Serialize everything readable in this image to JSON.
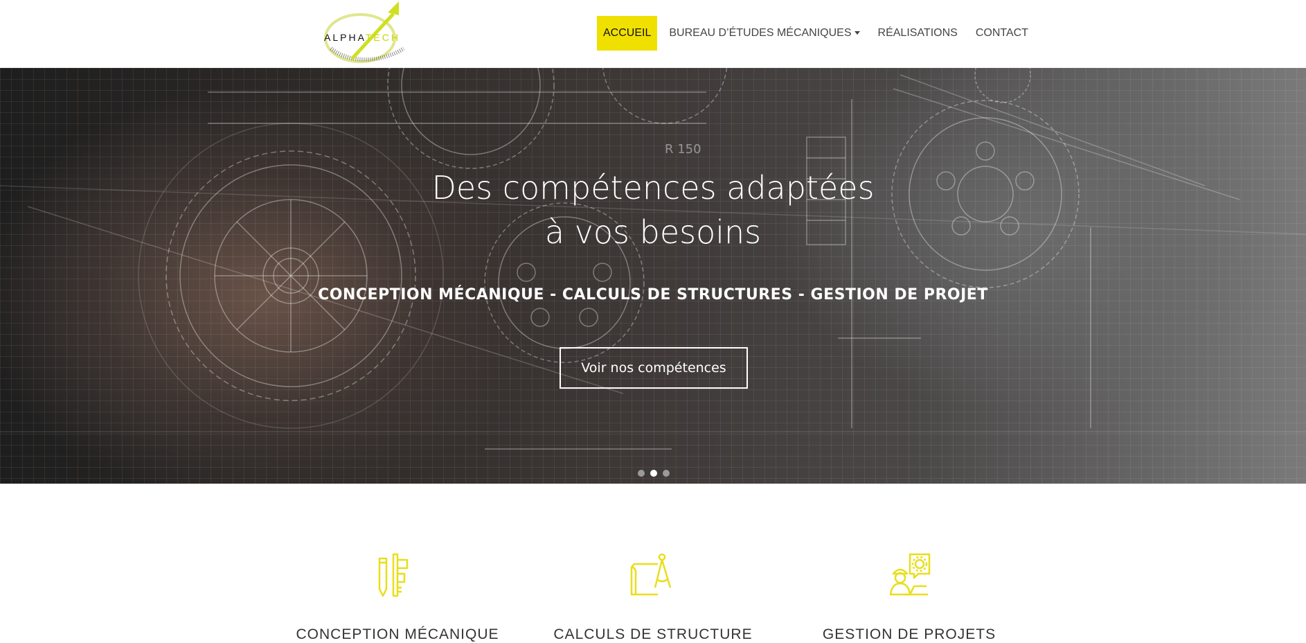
{
  "colors": {
    "accent": "#f0e000",
    "icon": "#e8df1a",
    "hero_text": "#ffffff"
  },
  "logo": {
    "part1": "ALPHA",
    "part2": "TECH"
  },
  "nav": {
    "items": [
      {
        "label": "ACCUEIL",
        "active": true
      },
      {
        "label": "BUREAU D’ÉTUDES MÉCANIQUES",
        "dropdown": true
      },
      {
        "label": "RÉALISATIONS"
      },
      {
        "label": "CONTACT"
      }
    ]
  },
  "hero": {
    "title_line1": "Des compétences adaptées",
    "title_line2": "à vos besoins",
    "subtitle": "CONCEPTION MÉCANIQUE - CALCULS DE STRUCTURES - GESTION DE PROJET",
    "button_label": "Voir nos compétences",
    "blueprint_label": "R 150",
    "slides_total": 3,
    "active_slide": 2
  },
  "features": [
    {
      "title": "CONCEPTION MÉCANIQUE",
      "icon": "pencil-caliper-icon"
    },
    {
      "title": "CALCULS DE STRUCTURE",
      "icon": "blueprint-compass-icon"
    },
    {
      "title": "GESTION DE PROJETS",
      "icon": "engineer-gear-icon"
    }
  ]
}
